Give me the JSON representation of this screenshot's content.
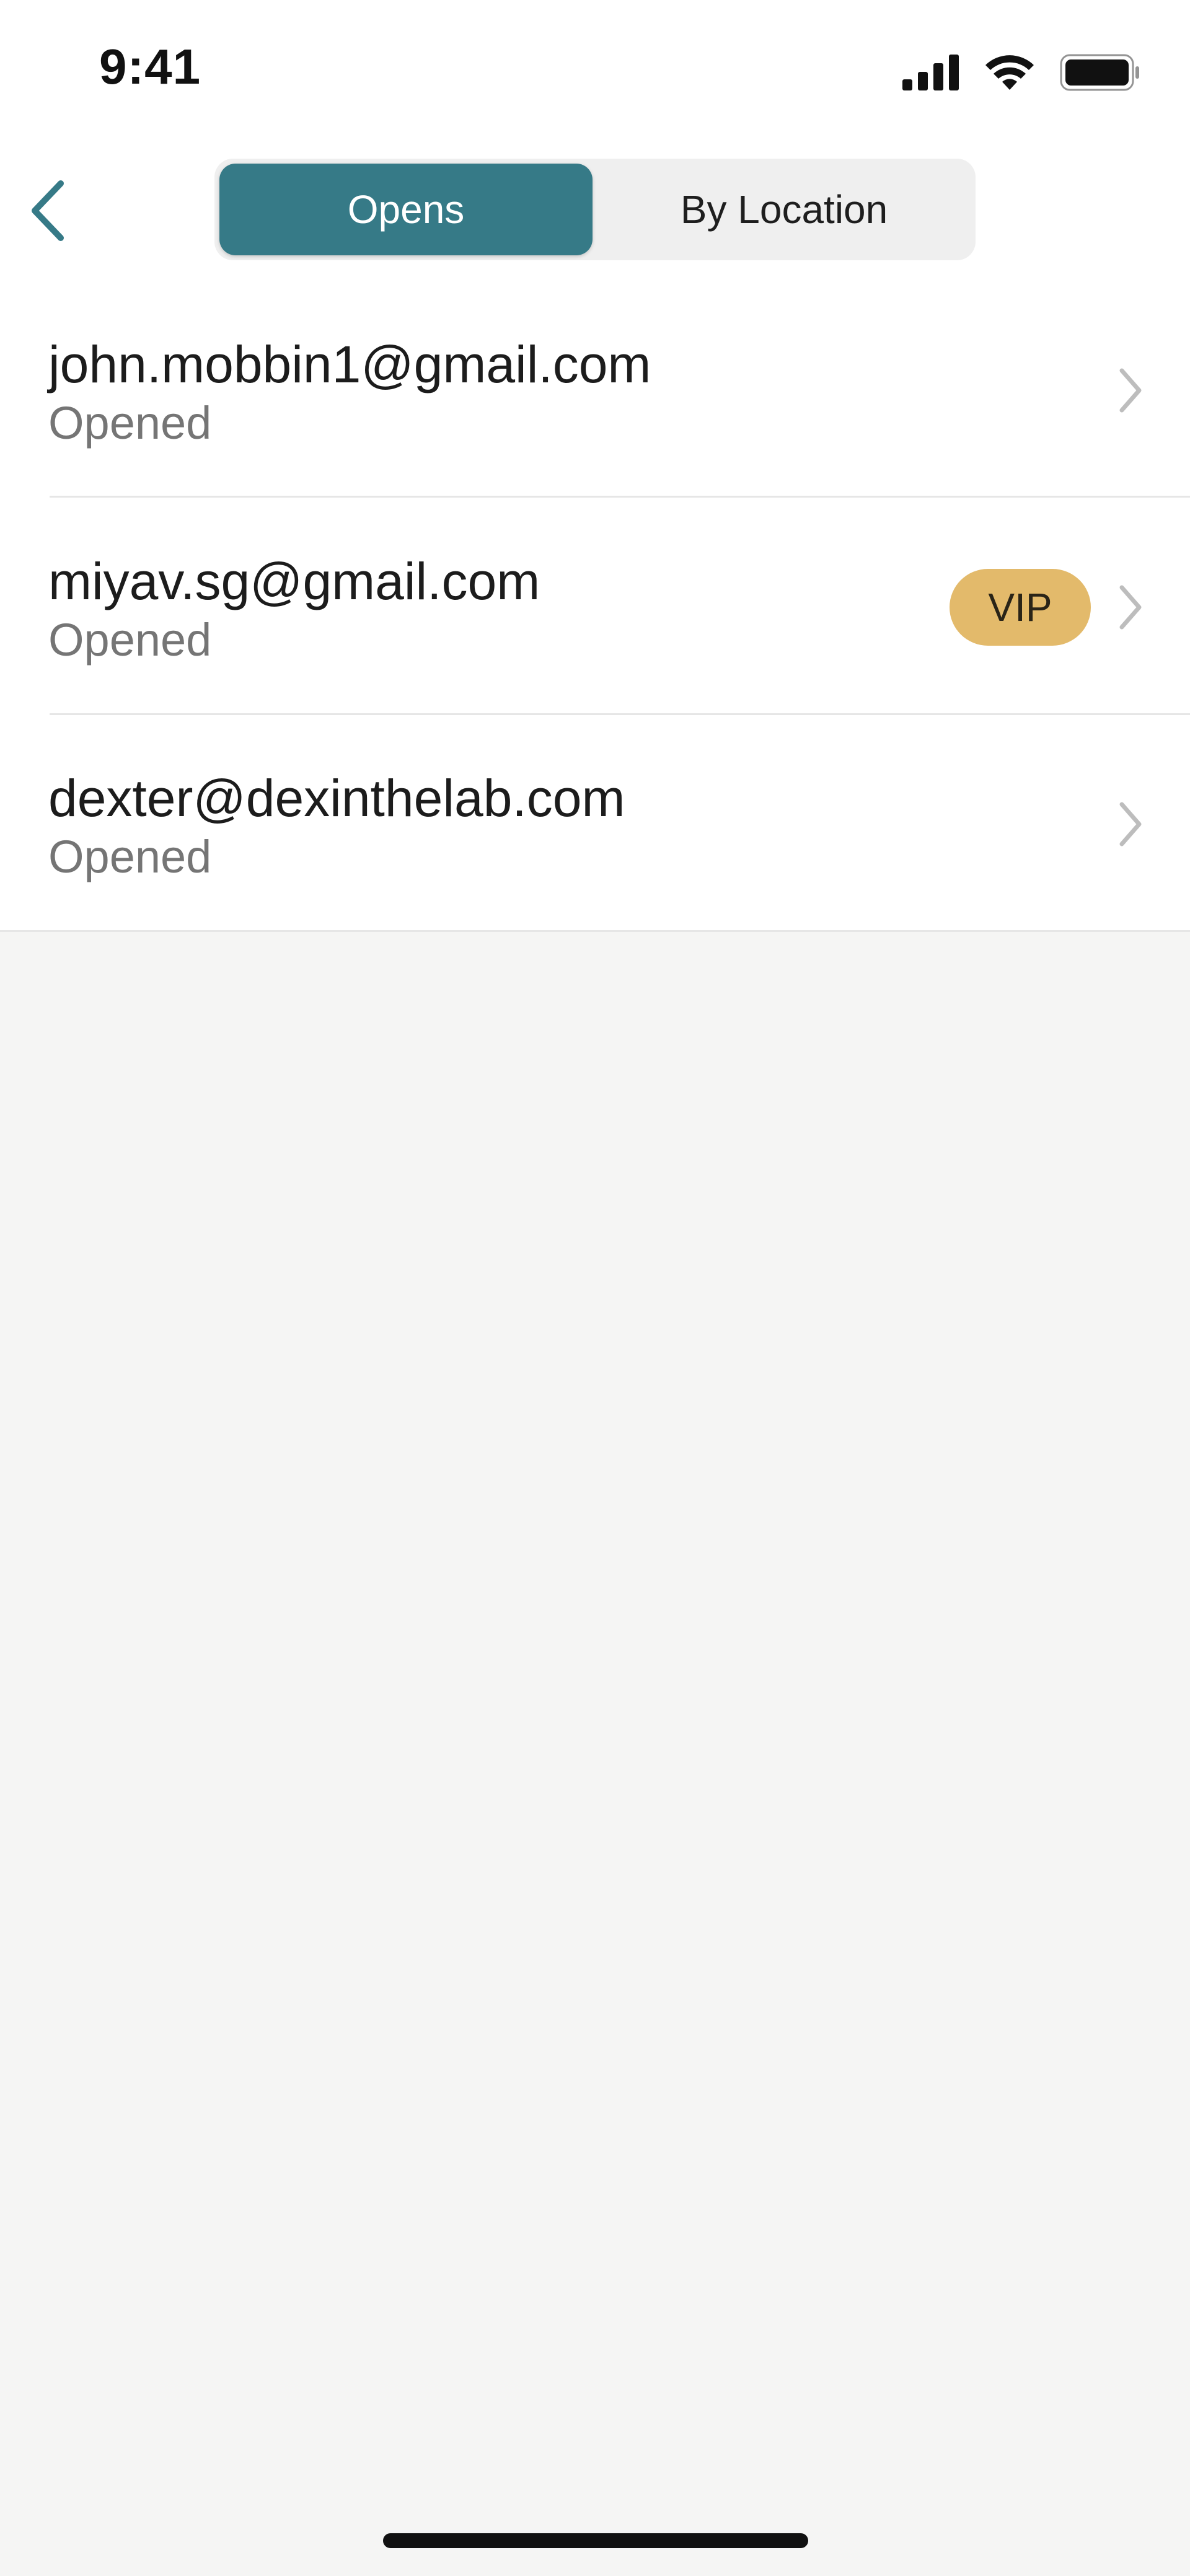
{
  "status_bar": {
    "time": "9:41"
  },
  "nav": {
    "back_icon": "chevron-left-icon",
    "segments": [
      {
        "label": "Opens",
        "selected": true
      },
      {
        "label": "By Location",
        "selected": false
      }
    ]
  },
  "list": {
    "rows": [
      {
        "email": "john.mobbin1@gmail.com",
        "status": "Opened",
        "badge": ""
      },
      {
        "email": "miyav.sg@gmail.com",
        "status": "Opened",
        "badge": "VIP"
      },
      {
        "email": "dexter@dexinthelab.com",
        "status": "Opened",
        "badge": ""
      }
    ]
  },
  "colors": {
    "accent": "#367a87",
    "vip_badge": "#e3ba6b",
    "background": "#f5f5f4",
    "secondary_text": "#757575"
  }
}
